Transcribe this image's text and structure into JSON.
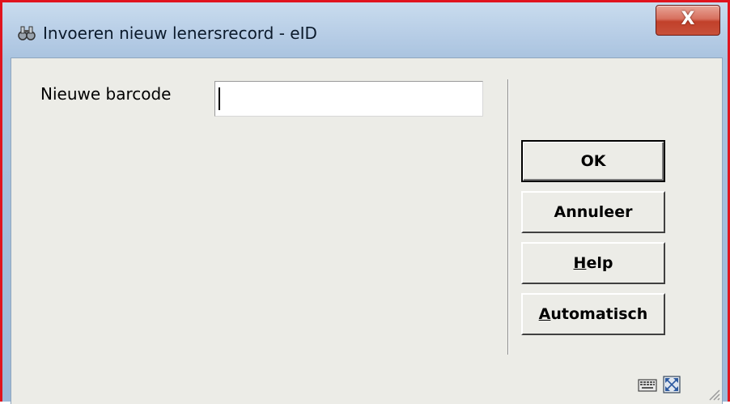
{
  "window": {
    "title": "Invoeren nieuw lenersrecord - eID",
    "close_label": "X",
    "icon": "binoculars-icon"
  },
  "form": {
    "barcode_label": "Nieuwe barcode",
    "barcode_value": ""
  },
  "buttons": {
    "ok": "OK",
    "cancel": "Annuleer",
    "help_mnemonic": "H",
    "help_rest": "elp",
    "auto_mnemonic": "A",
    "auto_rest": "utomatisch"
  },
  "status_bar": {
    "icons": [
      "keyboard-icon",
      "expand-icon",
      "resize-grip-icon"
    ]
  },
  "colors": {
    "frame_highlight": "#e0141e",
    "client_background": "#ecece7",
    "title_gradient_top": "#c9dcee",
    "close_button": "#c8513a"
  }
}
